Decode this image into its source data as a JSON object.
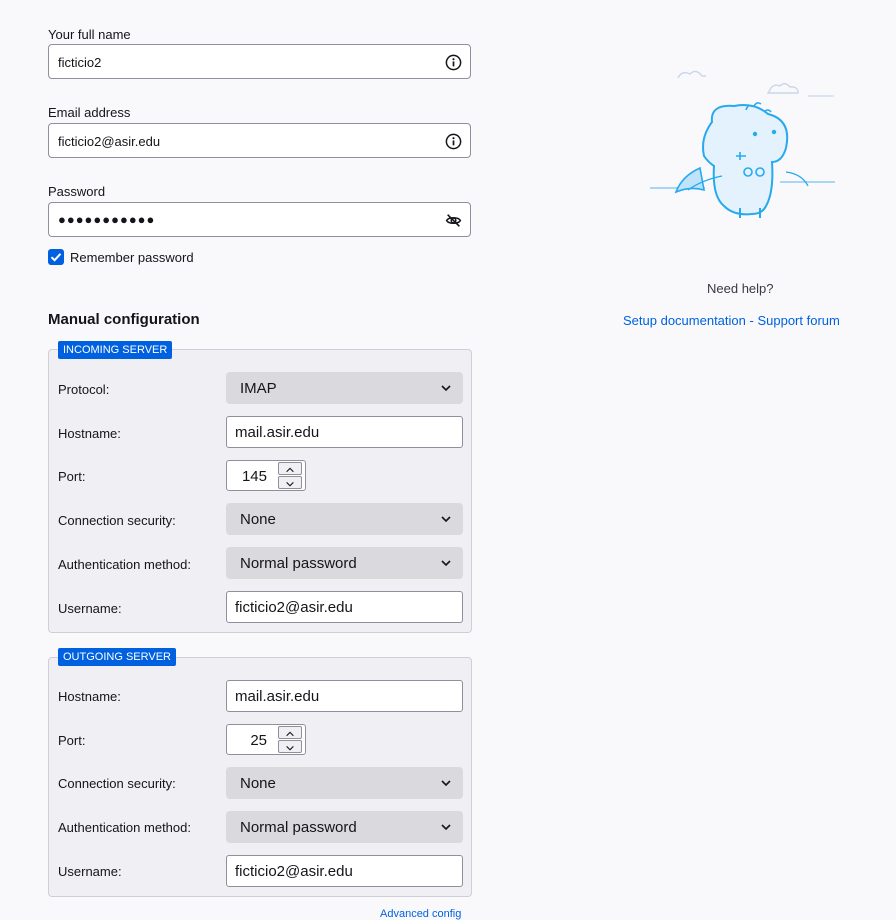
{
  "account": {
    "name_label": "Your full name",
    "name_value": "ficticio2",
    "email_label": "Email address",
    "email_value": "ficticio2@asir.edu",
    "password_label": "Password",
    "password_mask": "●●●●●●●●●●●",
    "remember_label": "Remember password",
    "remember_checked": true
  },
  "manual": {
    "title": "Manual configuration",
    "incoming": {
      "legend": "INCOMING SERVER",
      "protocol_label": "Protocol:",
      "protocol_value": "IMAP",
      "hostname_label": "Hostname:",
      "hostname_value": "mail.asir.edu",
      "port_label": "Port:",
      "port_value": "145",
      "security_label": "Connection security:",
      "security_value": "None",
      "auth_label": "Authentication method:",
      "auth_value": "Normal password",
      "username_label": "Username:",
      "username_value": "ficticio2@asir.edu"
    },
    "outgoing": {
      "legend": "OUTGOING SERVER",
      "hostname_label": "Hostname:",
      "hostname_value": "mail.asir.edu",
      "port_label": "Port:",
      "port_value": "25",
      "security_label": "Connection security:",
      "security_value": "None",
      "auth_label": "Authentication method:",
      "auth_value": "Normal password",
      "username_label": "Username:",
      "username_value": "ficticio2@asir.edu"
    },
    "advanced_link": "Advanced config"
  },
  "help": {
    "need_help": "Need help?",
    "setup_doc": "Setup documentation",
    "separator": "-",
    "support_forum": "Support forum"
  },
  "icons": {
    "info": "info-icon",
    "eye_off": "eye-off-icon",
    "check": "check-icon",
    "chevron": "chevron-down-icon"
  },
  "colors": {
    "accent": "#0061e0",
    "background": "#f9f9fb",
    "fieldset": "#f0f0f4",
    "select": "#d9d9de"
  }
}
